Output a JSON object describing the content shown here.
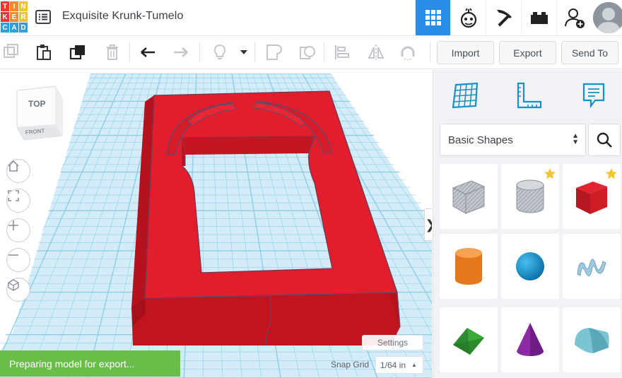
{
  "app": {
    "logo_letters": [
      "T",
      "I",
      "N",
      "K",
      "E",
      "R",
      "C",
      "A",
      "D"
    ],
    "logo_colors": [
      "#e8382f",
      "#f18b2a",
      "#f2c12d",
      "#e8382f",
      "#f18b2a",
      "#f2c12d",
      "#2e9fd8",
      "#2e9fd8",
      "#2e9fd8"
    ],
    "document_title": "Exquisite Krunk-Tumelo",
    "accent_color": "#2b8ce6"
  },
  "header": {
    "views": [
      {
        "name": "3d-design-view",
        "icon": "grid-icon",
        "active": true
      },
      {
        "name": "circuits-view",
        "icon": "pumpkin-bot-icon",
        "active": false
      },
      {
        "name": "codeblocks-view",
        "icon": "pickaxe-icon",
        "active": false
      },
      {
        "name": "bricks-view",
        "icon": "brick-icon",
        "active": false
      },
      {
        "name": "invite-view",
        "icon": "add-user-icon",
        "active": false
      }
    ]
  },
  "toolbar": {
    "import_label": "Import",
    "export_label": "Export",
    "send_to_label": "Send To"
  },
  "viewport": {
    "view_cube_top": "TOP",
    "view_cube_front": "FRONT",
    "status_message": "Preparing model for export...",
    "settings_label": "Settings",
    "snap_grid_label": "Snap Grid",
    "snap_grid_value": "1/64 in",
    "shape_color": "#e01f2d",
    "grid_color": "#8ecde8"
  },
  "side_panel": {
    "library_select": "Basic Shapes",
    "shapes": [
      {
        "name": "box-hole",
        "favorite": false
      },
      {
        "name": "cylinder-hole",
        "favorite": true
      },
      {
        "name": "box",
        "favorite": true
      },
      {
        "name": "cylinder",
        "favorite": false
      },
      {
        "name": "sphere",
        "favorite": false
      },
      {
        "name": "scribble",
        "favorite": false
      },
      {
        "name": "roof",
        "favorite": false
      },
      {
        "name": "cone",
        "favorite": false
      },
      {
        "name": "round-roof",
        "favorite": false
      }
    ]
  }
}
